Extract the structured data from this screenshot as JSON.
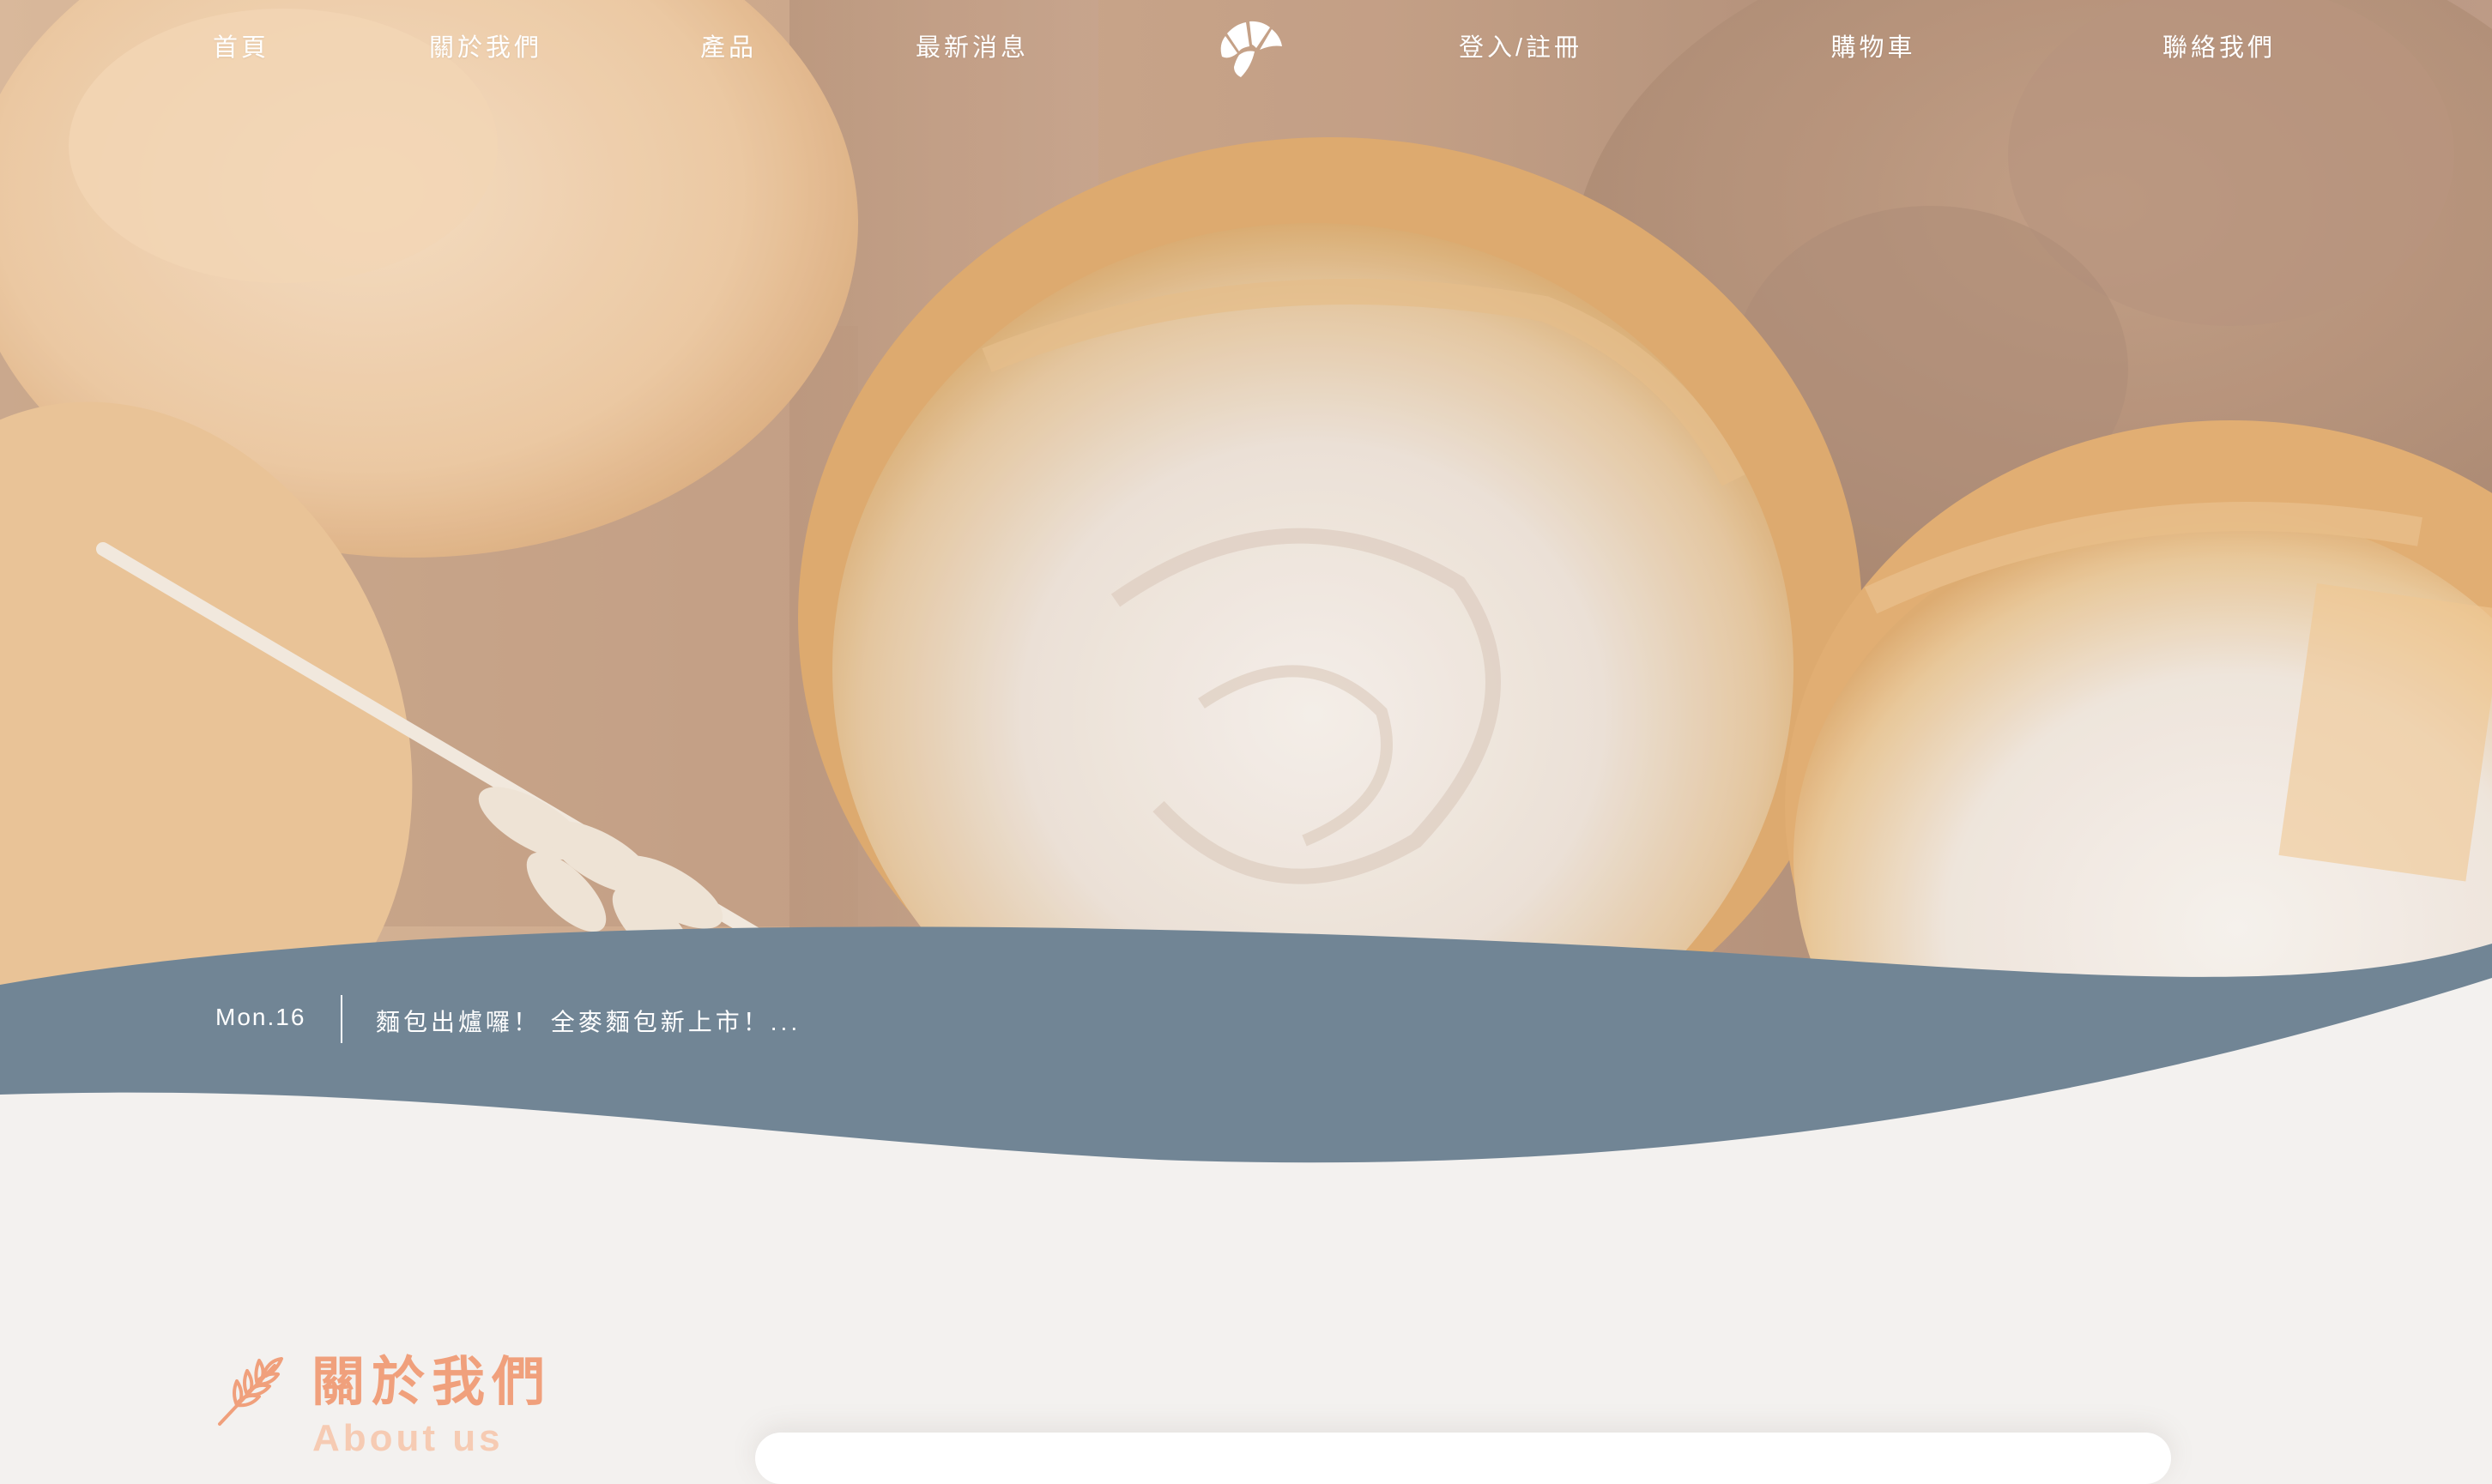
{
  "colors": {
    "banner": "#718595",
    "page_bg": "#f3f1ef",
    "accent": "#f0a07c",
    "accent_light": "#f6cbb3",
    "nav_text": "#ffffff"
  },
  "nav": {
    "items": [
      {
        "label": "首頁"
      },
      {
        "label": "關於我們"
      },
      {
        "label": "產品"
      },
      {
        "label": "最新消息"
      },
      {
        "label": "登入/註冊"
      },
      {
        "label": "購物車"
      },
      {
        "label": "聯絡我們"
      }
    ],
    "logo_icon": "croissant-icon"
  },
  "hero": {
    "image": "bread-rolls-photo"
  },
  "news": {
    "date": "Mon.16",
    "headline": "麵包出爐囉！ 全麥麵包新上市！..."
  },
  "about": {
    "title": "關於我們",
    "subtitle": "About us",
    "icon": "wheat-icon"
  }
}
